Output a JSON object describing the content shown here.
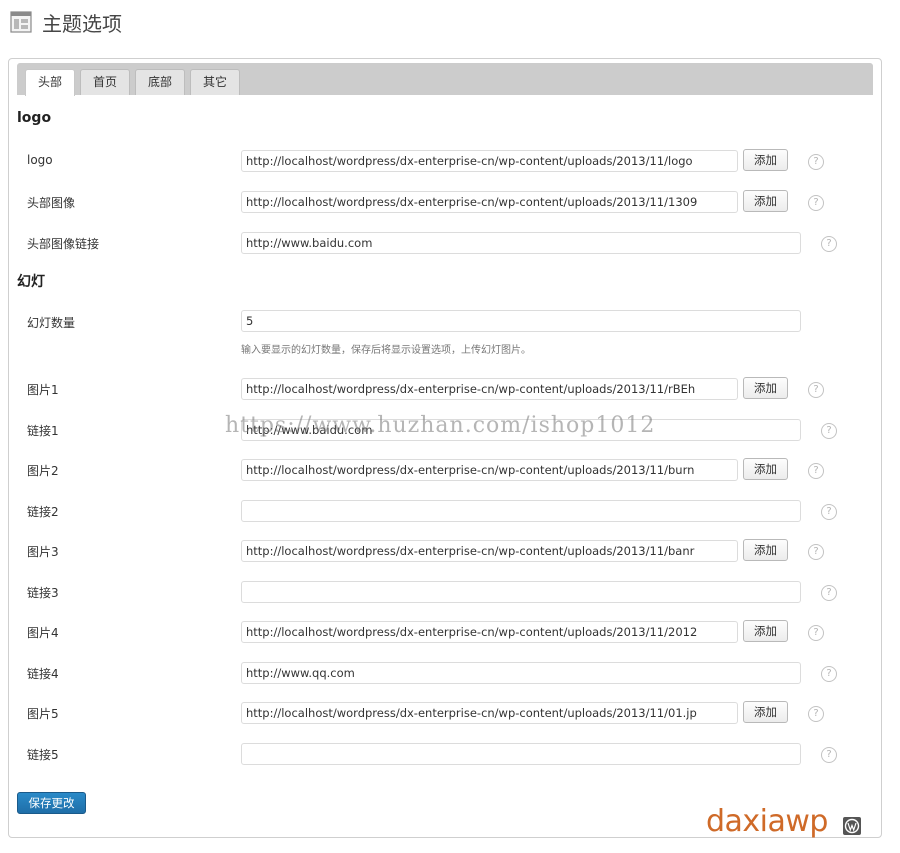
{
  "header": {
    "title": "主题选项",
    "icon": "layout-icon"
  },
  "tabs": [
    {
      "label": "头部",
      "active": true
    },
    {
      "label": "首页",
      "active": false
    },
    {
      "label": "底部",
      "active": false
    },
    {
      "label": "其它",
      "active": false
    }
  ],
  "sections": {
    "logo": {
      "title": "logo"
    },
    "slides": {
      "title": "幻灯"
    }
  },
  "rows": {
    "logo": {
      "label": "logo",
      "value": "http://localhost/wordpress/dx-enterprise-cn/wp-content/uploads/2013/11/logo"
    },
    "header_image": {
      "label": "头部图像",
      "value": "http://localhost/wordpress/dx-enterprise-cn/wp-content/uploads/2013/11/1309"
    },
    "header_image_link": {
      "label": "头部图像链接",
      "value": "http://www.baidu.com"
    },
    "slide_count": {
      "label": "幻灯数量",
      "value": "5",
      "hint": "输入要显示的幻灯数量，保存后将显示设置选项，上传幻灯图片。"
    },
    "image1": {
      "label": "图片1",
      "value": "http://localhost/wordpress/dx-enterprise-cn/wp-content/uploads/2013/11/rBEh"
    },
    "link1": {
      "label": "链接1",
      "value": "http://www.baidu.com"
    },
    "image2": {
      "label": "图片2",
      "value": "http://localhost/wordpress/dx-enterprise-cn/wp-content/uploads/2013/11/burn"
    },
    "link2": {
      "label": "链接2",
      "value": ""
    },
    "image3": {
      "label": "图片3",
      "value": "http://localhost/wordpress/dx-enterprise-cn/wp-content/uploads/2013/11/banr"
    },
    "link3": {
      "label": "链接3",
      "value": ""
    },
    "image4": {
      "label": "图片4",
      "value": "http://localhost/wordpress/dx-enterprise-cn/wp-content/uploads/2013/11/2012"
    },
    "link4": {
      "label": "链接4",
      "value": "http://www.qq.com"
    },
    "image5": {
      "label": "图片5",
      "value": "http://localhost/wordpress/dx-enterprise-cn/wp-content/uploads/2013/11/01.jp"
    },
    "link5": {
      "label": "链接5",
      "value": ""
    }
  },
  "buttons": {
    "add_label": "添加",
    "save_label": "保存更改"
  },
  "help_glyph": "?",
  "watermark": "https://www.huzhan.com/ishop1012",
  "brand": "daxiawp",
  "colors": {
    "accent": "#2271b1",
    "brand": "#cf6a28",
    "tabbar": "#cccccc"
  }
}
